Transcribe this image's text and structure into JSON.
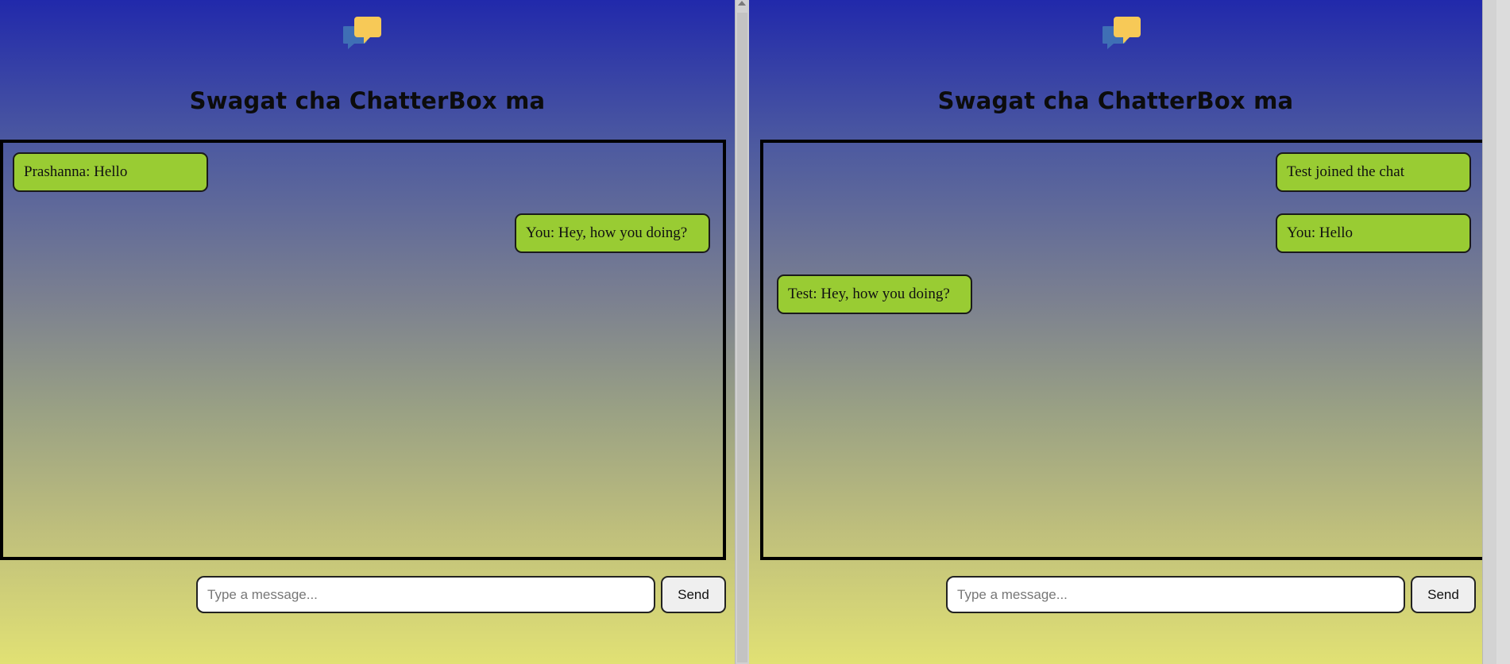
{
  "left_window": {
    "title": "Swagat cha ChatterBox ma",
    "logo_icon": "chat-bubbles-icon",
    "messages": [
      {
        "text": "Prashanna: Hello",
        "side": "left"
      },
      {
        "text": "You: Hey, how you doing?",
        "side": "right"
      }
    ],
    "input": {
      "placeholder": "Type a message...",
      "value": ""
    },
    "send_label": "Send"
  },
  "right_window": {
    "title": "Swagat cha ChatterBox ma",
    "logo_icon": "chat-bubbles-icon",
    "messages": [
      {
        "text": "Test joined the chat",
        "side": "right"
      },
      {
        "text": "You: Hello",
        "side": "right"
      },
      {
        "text": "Test: Hey, how you doing?",
        "side": "left"
      }
    ],
    "input": {
      "placeholder": "Type a message...",
      "value": ""
    },
    "send_label": "Send"
  },
  "colors": {
    "gradient_top": "#2129ab",
    "gradient_bottom": "#e1e174",
    "message_bubble": "#99cc33",
    "logo_blue": "#3f6fb5",
    "logo_yellow": "#f7c957"
  }
}
